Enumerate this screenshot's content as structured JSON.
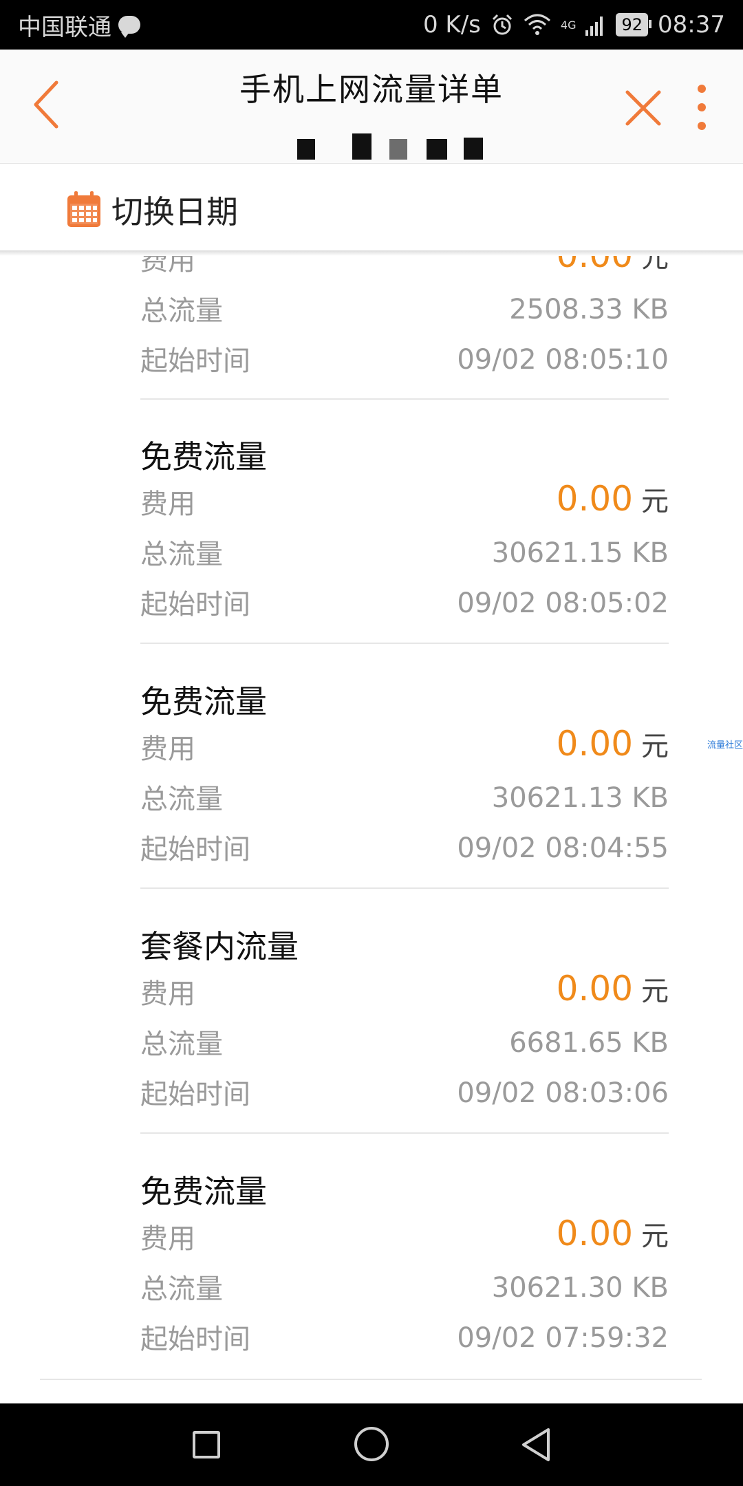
{
  "status_bar": {
    "carrier": "中国联通",
    "speed": "0 K/s",
    "network": "4G",
    "battery": "92",
    "time": "08:37"
  },
  "header": {
    "title": "手机上网流量详单"
  },
  "date_switcher": {
    "label": "切换日期"
  },
  "labels": {
    "fee": "费用",
    "total": "总流量",
    "start": "起始时间",
    "currency": "元"
  },
  "records": [
    {
      "type": "",
      "fee": "0.00",
      "total": "2508.33 KB",
      "start": "09/02 08:05:10"
    },
    {
      "type": "免费流量",
      "fee": "0.00",
      "total": "30621.15 KB",
      "start": "09/02 08:05:02"
    },
    {
      "type": "免费流量",
      "fee": "0.00",
      "total": "30621.13 KB",
      "start": "09/02 08:04:55"
    },
    {
      "type": "套餐内流量",
      "fee": "0.00",
      "total": "6681.65 KB",
      "start": "09/02 08:03:06"
    },
    {
      "type": "免费流量",
      "fee": "0.00",
      "total": "30621.30 KB",
      "start": "09/02 07:59:32"
    }
  ],
  "watermark": "流量社区",
  "colors": {
    "accent": "#f08a1a",
    "icon": "#f07a3a",
    "muted_text": "#9a9a9a"
  }
}
